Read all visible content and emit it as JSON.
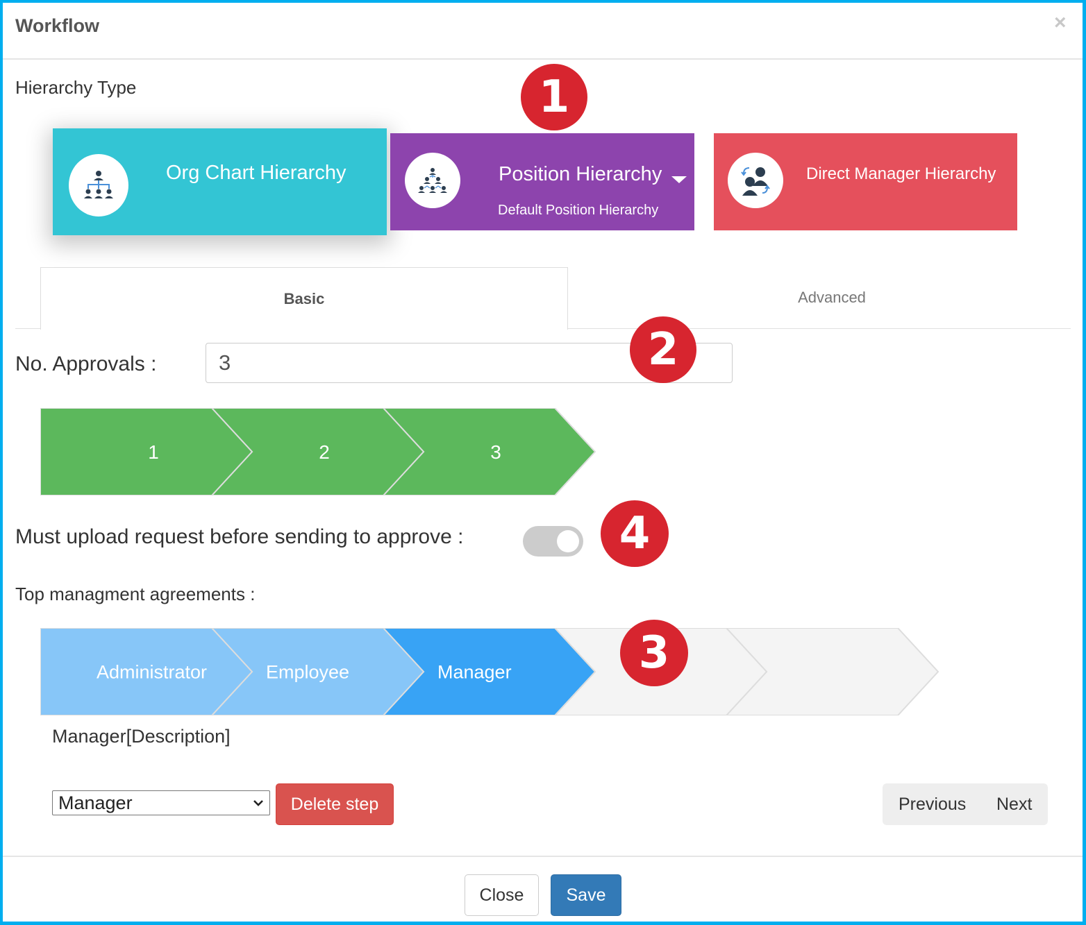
{
  "modal": {
    "title": "Workflow",
    "close_icon": "×"
  },
  "hierarchy": {
    "label": "Hierarchy Type",
    "cards": [
      {
        "title": "Org Chart Hierarchy",
        "subtitle": "",
        "icon": "org-chart-icon",
        "color": "#33C5D4",
        "selected": true
      },
      {
        "title": "Position Hierarchy",
        "subtitle": "Default Position Hierarchy",
        "icon": "position-hierarchy-icon",
        "color": "#8D44AD",
        "has_dropdown": true
      },
      {
        "title": "Direct Manager Hierarchy",
        "subtitle": "",
        "icon": "direct-manager-icon",
        "color": "#E5505C"
      }
    ]
  },
  "tabs": [
    {
      "label": "Basic",
      "active": true
    },
    {
      "label": "Advanced",
      "active": false
    }
  ],
  "approvals": {
    "label": "No. Approvals :",
    "value": "3"
  },
  "approval_steps": {
    "color": "#5CB85C",
    "items": [
      "1",
      "2",
      "3"
    ]
  },
  "upload_toggle": {
    "label": "Must upload request before sending to approve :",
    "checked": false
  },
  "top_management": {
    "label": "Top managment agreements :",
    "steps": [
      {
        "label": "Administrator",
        "state": "done"
      },
      {
        "label": "Employee",
        "state": "done"
      },
      {
        "label": "Manager",
        "state": "current"
      },
      {
        "label": "",
        "state": "empty"
      },
      {
        "label": "",
        "state": "empty"
      }
    ],
    "colors": {
      "done": "#87C6F8",
      "current": "#38A3F5",
      "empty": "#F4F4F4"
    },
    "description": "Manager[Description]",
    "select_value": "Manager",
    "delete_label": "Delete step",
    "previous_label": "Previous",
    "next_label": "Next"
  },
  "annotations": [
    "1",
    "2",
    "3",
    "4"
  ],
  "footer": {
    "close_label": "Close",
    "save_label": "Save"
  }
}
